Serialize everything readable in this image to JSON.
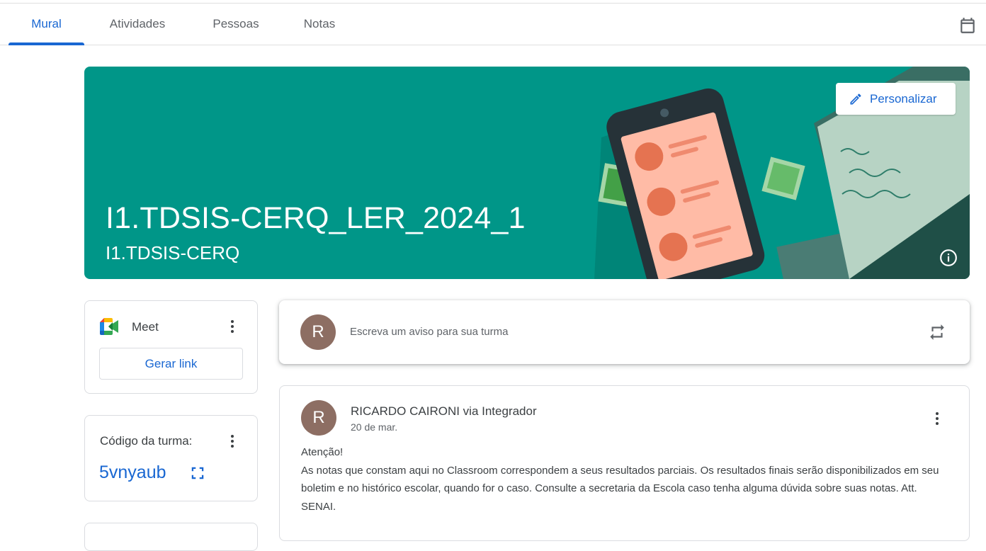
{
  "tabs": [
    {
      "label": "Mural",
      "active": true
    },
    {
      "label": "Atividades",
      "active": false
    },
    {
      "label": "Pessoas",
      "active": false
    },
    {
      "label": "Notas",
      "active": false
    }
  ],
  "header": {
    "calendar_icon": "calendar-icon"
  },
  "banner": {
    "title": "I1.TDSIS-CERQ_LER_2024_1",
    "subtitle": "I1.TDSIS-CERQ",
    "customize_label": "Personalizar",
    "color": "#009688",
    "customize_icon": "pencil-icon",
    "info_icon": "info-icon"
  },
  "meet": {
    "label": "Meet",
    "button_label": "Gerar link",
    "icon": "google-meet-icon"
  },
  "class_code": {
    "label": "Código da turma:",
    "value": "5vnyaub",
    "expand_icon": "fullscreen-icon"
  },
  "announce": {
    "avatar_letter": "R",
    "placeholder": "Escreva um aviso para sua turma",
    "repost_icon": "repost-icon"
  },
  "post": {
    "avatar_letter": "R",
    "author": "RICARDO CAIRONI via Integrador",
    "date": "20 de mar.",
    "body_line1": "Atenção!",
    "body_line2": "As notas que constam aqui no Classroom correspondem a seus resultados parciais. Os resultados finais serão disponibilizados em seu boletim e no histórico escolar, quando for o caso. Consulte a secretaria da Escola caso tenha alguma dúvida sobre suas notas. Att. SENAI."
  },
  "colors": {
    "accent": "#1967d2",
    "avatar": "#8d6e63"
  }
}
